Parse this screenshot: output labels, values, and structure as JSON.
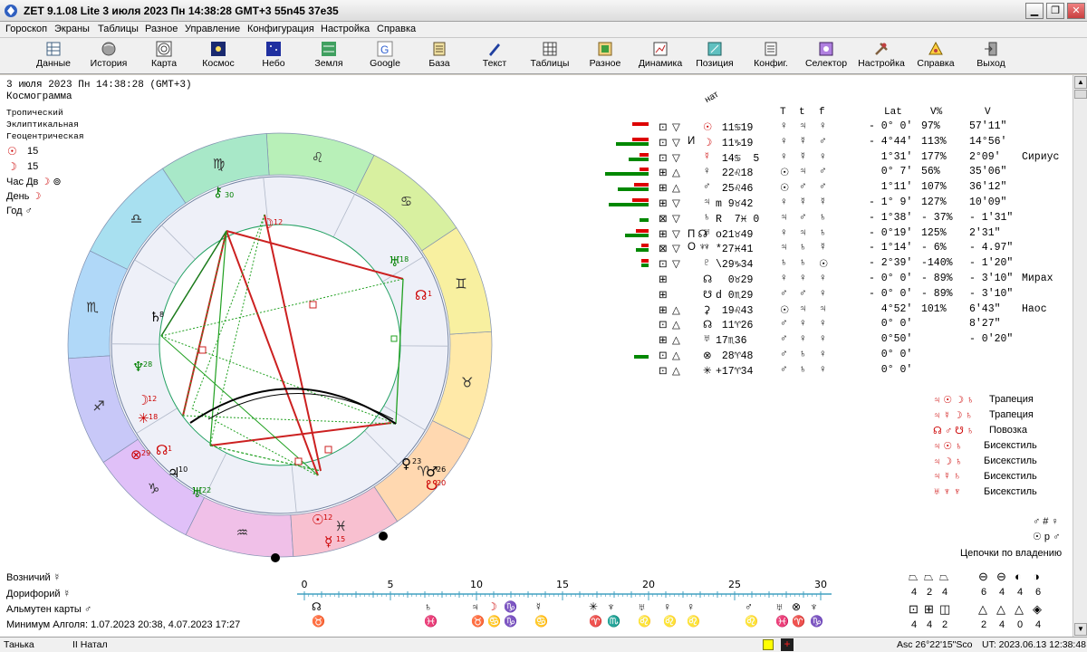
{
  "window": {
    "title": "ZET 9.1.08 Lite     3 июля 2023  Пн  14:38:28 GMT+3 55n45  37e35"
  },
  "menu": [
    "Гороскоп",
    "Экраны",
    "Таблицы",
    "Разное",
    "Управление",
    "Конфигурация",
    "Настройка",
    "Справка"
  ],
  "toolbar": [
    "Данные",
    "История",
    "Карта",
    "Космос",
    "Небо",
    "Земля",
    "Google",
    "База",
    "Текст",
    "Таблицы",
    "Разное",
    "Динамика",
    "Позиция",
    "Конфиг.",
    "Селектор",
    "Настройка",
    "Справка",
    "Выход"
  ],
  "info": {
    "date_line": "3 июля 2023  Пн  14:38:28 (GMT+3)",
    "chart_kind": "Космограмма",
    "zodiac": "Тропический",
    "coords": "Эклиптикальная",
    "center": "Геоцентрическая",
    "sun_num": "15",
    "moon_num": "15",
    "hour_label": "Час Дв",
    "day_label": "День",
    "year_label": "Год"
  },
  "table": {
    "headers": {
      "nat": "нат",
      "T": "T",
      "t": "t",
      "f": "f",
      "lat": "Lat",
      "vperc": "V%",
      "v": "V"
    },
    "rows": [
      {
        "planet": "☉",
        "pos": " 11♋19",
        "T": "♀",
        "t": "♃",
        "f": "♀",
        "lat": "- 0° 0'",
        "vp": "97%",
        "v": "57'11\"",
        "star": ""
      },
      {
        "planet": "☽",
        "pos": " 11♑19",
        "T": "♀",
        "t": "☿",
        "f": "♂",
        "lat": "- 4°44'",
        "vp": "113%",
        "v": "14°56'",
        "star": ""
      },
      {
        "planet": "☿",
        "pos": " 14♋  5",
        "T": "♀",
        "t": "☿",
        "f": "♀",
        "lat": "  1°31'",
        "vp": "177%",
        "v": "2°09'",
        "star": "Сириус"
      },
      {
        "planet": "♀",
        "pos": " 22♌18",
        "T": "☉",
        "t": "♃",
        "f": "♂",
        "lat": "  0° 7'",
        "vp": "56%",
        "v": "35'06\"",
        "star": ""
      },
      {
        "planet": "♂",
        "pos": " 25♌46",
        "T": "☉",
        "t": "♂",
        "f": "♂",
        "lat": "  1°11'",
        "vp": "107%",
        "v": "36'12\"",
        "star": ""
      },
      {
        "planet": "♃",
        "pos": "m 9♉42",
        "T": "♀",
        "t": "☿",
        "f": "☿",
        "lat": "- 1° 9'",
        "vp": "127%",
        "v": "10'09\"",
        "star": ""
      },
      {
        "planet": "♄",
        "pos": "R  7♓ 0",
        "T": "♃",
        "t": "♂",
        "f": "♄",
        "lat": "- 1°38'",
        "vp": "- 37%",
        "v": "- 1'31\"",
        "star": ""
      },
      {
        "planet": "♅",
        "pos": "o21♉49",
        "T": "♀",
        "t": "♃",
        "f": "♄",
        "lat": "- 0°19'",
        "vp": "125%",
        "v": "2'31\"",
        "star": ""
      },
      {
        "planet": "♆",
        "pos": "*27♓41",
        "T": "♃",
        "t": "♄",
        "f": "☿",
        "lat": "- 1°14'",
        "vp": "- 6%",
        "v": "- 4.97\"",
        "star": ""
      },
      {
        "planet": "♇",
        "pos": "\\29♑34",
        "T": "♄",
        "t": "♄",
        "f": "☉",
        "lat": "- 2°39'",
        "vp": "-140%",
        "v": "- 1'20\"",
        "star": ""
      },
      {
        "planet": "☊",
        "pos": "  0♉29",
        "T": "♀",
        "t": "♀",
        "f": "♀",
        "lat": "- 0° 0'",
        "vp": "- 89%",
        "v": "- 3'10\"",
        "star": "Мирах"
      },
      {
        "planet": "☋",
        "pos": "d 0♏29",
        "T": "♂",
        "t": "♂",
        "f": "♀",
        "lat": "- 0° 0'",
        "vp": "- 89%",
        "v": "- 3'10\"",
        "star": ""
      },
      {
        "planet": "⚳",
        "pos": " 19♌43",
        "T": "☉",
        "t": "♃",
        "f": "♃",
        "lat": "  4°52'",
        "vp": "101%",
        "v": "6'43\"",
        "star": "Наос"
      },
      {
        "planet": "☊",
        "pos": " 11♈26",
        "T": "♂",
        "t": "♀",
        "f": "♀",
        "lat": "  0° 0'",
        "vp": "",
        "v": "8'27\"",
        "star": ""
      },
      {
        "planet": "♅",
        "pos": "17♏36",
        "T": "♂",
        "t": "♀",
        "f": "♀",
        "lat": "  0°50'",
        "vp": "",
        "v": "- 0'20\"",
        "star": ""
      },
      {
        "planet": "⊗",
        "pos": " 28♈48",
        "T": "♂",
        "t": "♄",
        "f": "♀",
        "lat": "  0° 0'",
        "vp": "",
        "v": "",
        "star": ""
      },
      {
        "planet": "✳",
        "pos": "+17♈34",
        "T": "♂",
        "t": "♄",
        "f": "♀",
        "lat": "  0° 0'",
        "vp": "",
        "v": "",
        "star": ""
      }
    ]
  },
  "configurations": [
    {
      "glyphs": "♃ ☉ ☽ ♄",
      "name": "Трапеция"
    },
    {
      "glyphs": "♃ ☿ ☽ ♄",
      "name": "Трапеция"
    },
    {
      "glyphs": "☊ ♂ ☋ ♄",
      "name": "Повозка"
    },
    {
      "glyphs": "♃ ☉ ♄",
      "name": "Бисекстиль"
    },
    {
      "glyphs": "♃ ☽ ♄",
      "name": "Бисекстиль"
    },
    {
      "glyphs": "♃ ☿ ♄",
      "name": "Бисекстиль"
    },
    {
      "glyphs": "♅ ♆ ♆",
      "name": "Бисекстиль"
    }
  ],
  "right_small": {
    "line1": "♂ # ♀",
    "line2": "☉ р ♂"
  },
  "chains": {
    "title": "Цепочки по владению",
    "row1_nums": [
      "4",
      "2",
      "4"
    ],
    "row1b_nums": [
      "6",
      "4",
      "4",
      "6"
    ],
    "row2_nums": [
      "4",
      "4",
      "2"
    ],
    "row2b_nums": [
      "2",
      "4",
      "0",
      "4"
    ]
  },
  "bottom": {
    "voznichiy": "Возничий",
    "doriforiy": "Дорифорий",
    "almuten": "Альмутен карты",
    "algol": "Минимум Алголя: 1.07.2023 20:38,  4.07.2023 17:27"
  },
  "timeline": {
    "ticks": [
      "0",
      "5",
      "10",
      "15",
      "20",
      "25",
      "30"
    ]
  },
  "status": {
    "left": "Танька",
    "mid": "II Натал",
    "asc": "Asc  26°22'15\"Sco",
    "ut": "UT: 2023.06.13 12:38:48"
  },
  "colors": {
    "aries": "#ffd8b0",
    "taurus": "#ffe9a8",
    "gemini": "#f8f0a0",
    "cancer": "#d8f0a0",
    "leo": "#b8f0b8",
    "virgo": "#a8e8c8",
    "libra": "#a8e0f0",
    "scorpio": "#b0d8f8",
    "sagittarius": "#c8c8f8",
    "capricorn": "#e0c0f8",
    "aquarius": "#f0c0e8",
    "pisces": "#f8c0d0"
  }
}
